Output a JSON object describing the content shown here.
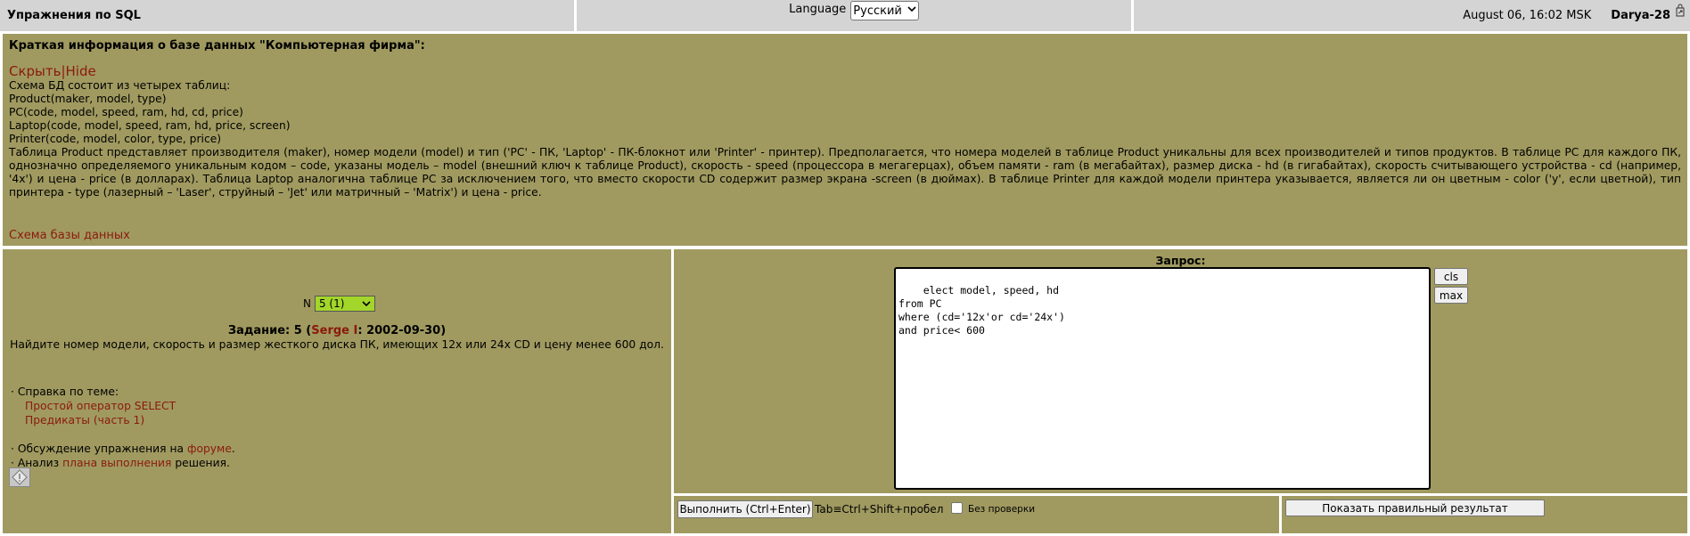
{
  "header": {
    "site_title": "Упражнения по SQL",
    "language_label": "Language",
    "language_value": "Русский",
    "datetime": "August 06, 16:02 MSK",
    "user": "Darya-28",
    "icons": [
      "chevron-down-icon",
      "logout-icon"
    ]
  },
  "info": {
    "heading": "Краткая информация о базе данных \"Компьютерная фирма\":",
    "hide_link": "Скрыть|Hide",
    "schema_intro": "Схема БД состоит из четырех таблиц:",
    "tables": [
      "Product(maker, model, type)",
      "PC(code, model, speed, ram, hd, cd, price)",
      "Laptop(code, model, speed, ram, hd, price, screen)",
      "Printer(code, model, color, type, price)"
    ],
    "description": "Таблица Product представляет производителя (maker), номер модели (model) и тип ('PC' - ПК, 'Laptop' - ПК-блокнот или 'Printer' - принтер). Предполагается, что номера моделей в таблице Product уникальны для всех производителей и типов продуктов. В таблице PC для каждого ПК, однозначно определяемого уникальным кодом – code, указаны модель – model (внешний ключ к таблице Product), скорость - speed (процессора в мегагерцах), объем памяти - ram (в мегабайтах), размер диска - hd (в гигабайтах), скорость считывающего устройства - cd (например, '4x') и цена - price (в долларах). Таблица Laptop аналогична таблице PC за исключением того, что вместо скорости CD содержит размер экрана -screen (в дюймах). В таблице Printer для каждой модели принтера указывается, является ли он цветным - color ('y', если цветной), тип принтера - type (лазерный – 'Laser', струйный – 'Jet' или матричный – 'Matrix') и цена - price.",
    "schema_link": "Схема базы данных"
  },
  "task": {
    "n_label": "N",
    "n_value": "5 (1)",
    "title_prefix": "Задание: 5 (",
    "author": "Serge I",
    "title_suffix": ": 2002-09-30)",
    "text": "Найдите номер модели, скорость и размер жесткого диска ПК, имеющих 12x или 24x CD и цену менее 600 дол.",
    "help_label": "· Справка по теме:",
    "help_links": [
      "Простой оператор SELECT",
      "Предикаты (часть 1)"
    ],
    "forum_prefix": "· Обсуждение упражнения на ",
    "forum_link": "форуме",
    "forum_suffix": ".",
    "plan_prefix": "· Анализ ",
    "plan_link": "плана выполнения",
    "plan_suffix": " решения."
  },
  "query": {
    "label": "Запрос:",
    "text": "elect model, speed, hd\nfrom PC\nwhere (cd='12x'or cd='24x')\nand price< 600",
    "cls_label": "cls",
    "max_label": "max",
    "run_label": "Выполнить (Ctrl+Enter)",
    "tab_hint": "Tab≡Ctrl+Shift+пробел",
    "no_check_label": "Без  проверки",
    "show_result_label": "Показать правильный результат"
  },
  "colors": {
    "panel": "#a09a60",
    "header": "#d4d4d4",
    "link": "#8b1a0c",
    "select_green": "#a3d62a"
  }
}
